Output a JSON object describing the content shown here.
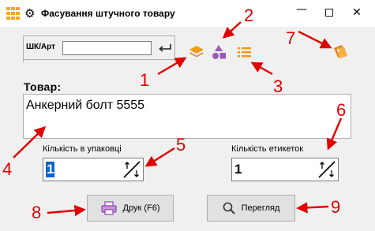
{
  "window": {
    "title": "Фасування штучного товару",
    "minimize_glyph": "—",
    "close_glyph": "✕",
    "gear_glyph": "⚙"
  },
  "barcode": {
    "label": "ШК/Арт",
    "value": "",
    "enter_icon": "enter-return-icon"
  },
  "toolbar": {
    "icons": [
      "layers-icon",
      "shapes-icon",
      "list-icon",
      "tag-icon"
    ]
  },
  "goods": {
    "label": "Товар:",
    "value": "Анкерний болт 5555"
  },
  "pack_qty": {
    "label": "Кількість в упаковці",
    "value": "1"
  },
  "labels_qty": {
    "label": "Кількість етикеток",
    "value": "1"
  },
  "buttons": {
    "print_label": "Друк (F6)",
    "view_label": "Перегляд"
  },
  "annotations": [
    "1",
    "2",
    "3",
    "4",
    "5",
    "6",
    "7",
    "8",
    "9"
  ],
  "colors": {
    "accent_orange": "#f39c12",
    "accent_purple": "#9b59b6",
    "annotation_red": "#e00000",
    "selection_blue": "#0a64c8"
  }
}
